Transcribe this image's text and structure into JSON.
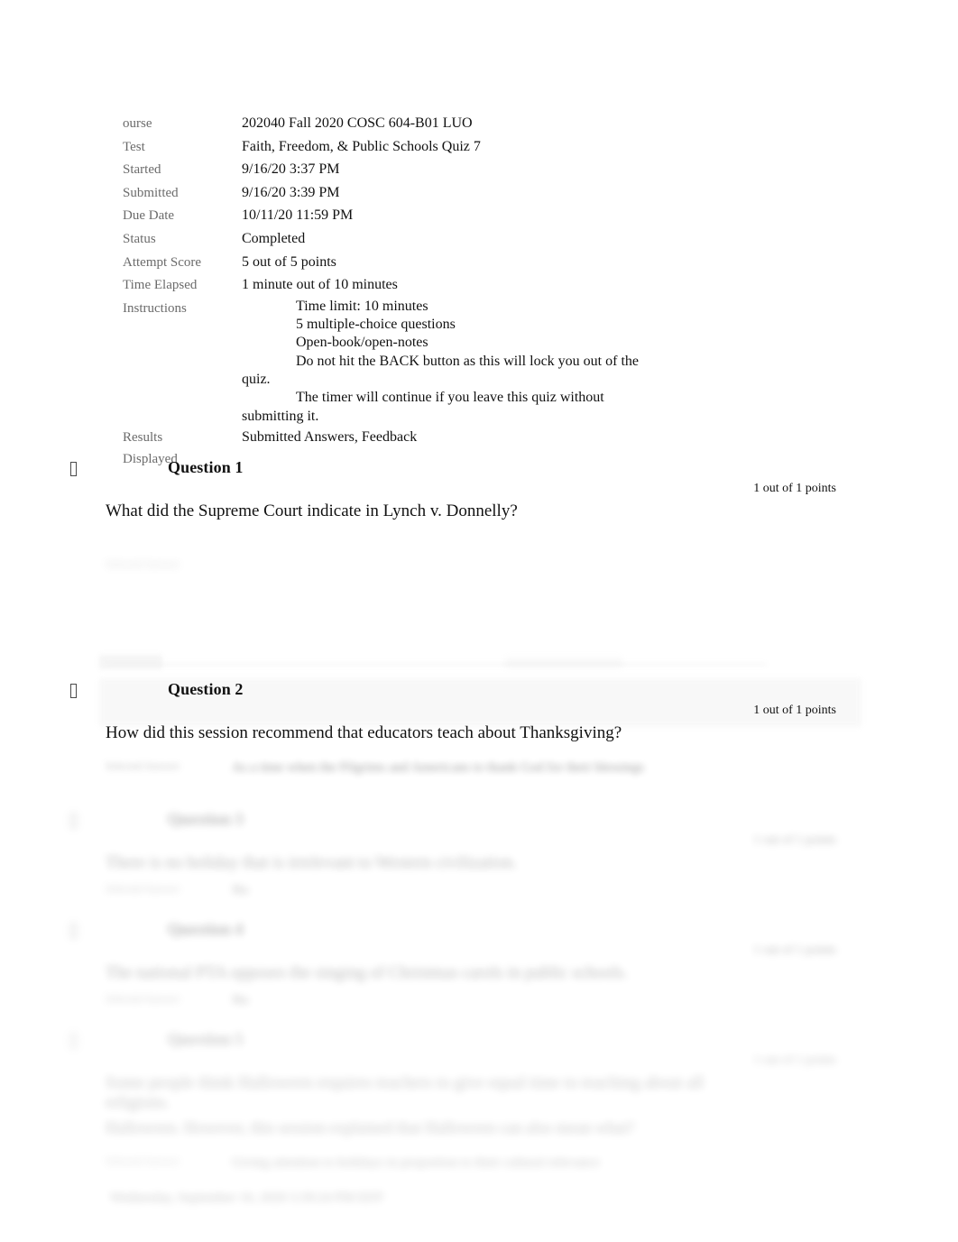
{
  "summary": {
    "rows": [
      {
        "label": "ourse",
        "value": "202040 Fall 2020 COSC 604-B01 LUO"
      },
      {
        "label": "Test",
        "value": "Faith, Freedom, & Public Schools Quiz 7"
      },
      {
        "label": "Started",
        "value": "9/16/20 3:37 PM"
      },
      {
        "label": "Submitted",
        "value": "9/16/20 3:39 PM"
      },
      {
        "label": "Due Date",
        "value": "10/11/20 11:59 PM"
      },
      {
        "label": "Status",
        "value": "Completed"
      },
      {
        "label": "Attempt Score",
        "value": "5 out of 5 points"
      },
      {
        "label": "Time Elapsed",
        "value": "1 minute out of 10 minutes"
      }
    ],
    "instructions_label": "Instructions",
    "instructions_lines": [
      "Time limit: 10 minutes",
      "5 multiple-choice questions",
      "Open-book/open-notes",
      "Do not hit the BACK button as this will lock you out of the quiz.",
      "The timer will continue if you leave this quiz without submitting it."
    ],
    "results_label_line1": "Results",
    "results_label_line2": "Displayed",
    "results_value": "Submitted Answers, Feedback"
  },
  "questions": [
    {
      "title": "Question 1",
      "points": "1 out of 1 points",
      "text": "What did the Supreme Court indicate in Lynch v. Donnelly?",
      "answer_label": "Selected Answer:",
      "answer_value": ""
    },
    {
      "title": "Question 2",
      "points": "1 out of 1 points",
      "text": "How did this session recommend that educators teach about Thanksgiving?",
      "answer_label": "Selected Answer:",
      "answer_value": "As a time when the Pilgrims and Americans to thank God for their blessings"
    },
    {
      "title": "Question 3",
      "points": "1 out of 1 points",
      "text": "There is no holiday that is irrelevant to Western civilization.",
      "answer_label": "Selected Answer:",
      "answer_value": "No"
    },
    {
      "title": "Question 4",
      "points": "1 out of 1 points",
      "text": "The national PTA opposes the singing of Christmas carols in public schools.",
      "answer_label": "Selected Answer:",
      "answer_value": "No"
    },
    {
      "title": "Question 5",
      "points": "1 out of 1 points",
      "text": "Some people think Halloween requires teachers to give equal time to teaching about all religions.",
      "text_line2": "Halloween. However, this session explained that Halloween can also mean what?",
      "answer_label": "Selected Answer:",
      "answer_value": "Giving attention to holidays in proportion to their cultural relevance",
      "footer": "Wednesday, September 16, 2020 3:39:24 PM EDT"
    }
  ],
  "colors": {
    "label": "#6b6b6b",
    "text": "#111111",
    "band": "#f4f4f4",
    "rule": "#d8d8d8"
  }
}
